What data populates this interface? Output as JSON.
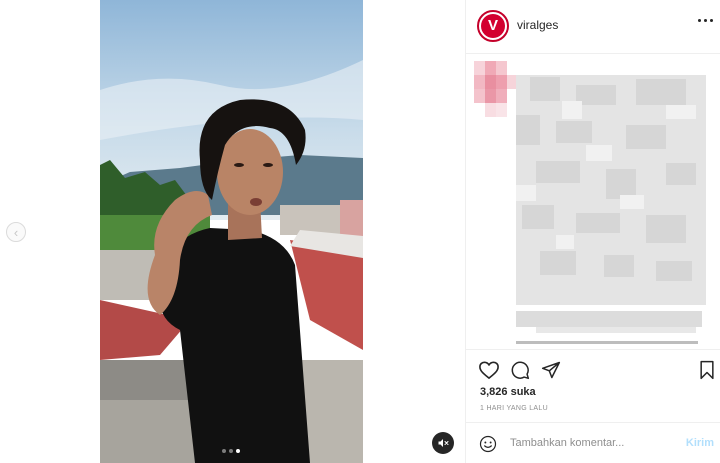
{
  "post": {
    "username": "viralges",
    "avatar_letter": "V",
    "likes": "3,826 suka",
    "timestamp": "1 HARI YANG LALU",
    "carousel_count": 3,
    "carousel_active_index": 2
  },
  "comment": {
    "placeholder": "Tambahkan komentar...",
    "post_label": "Kirim"
  },
  "icons": {
    "prev": "chevron-left-icon",
    "mute": "mute-icon",
    "more": "more-icon",
    "like": "heart-icon",
    "comment": "comment-icon",
    "share": "paper-plane-icon",
    "save": "bookmark-icon",
    "emoji": "emoji-icon"
  },
  "colors": {
    "brand": "#d3002f",
    "post_disabled": "#b2dffc",
    "muted_text": "#8e8e8e"
  }
}
